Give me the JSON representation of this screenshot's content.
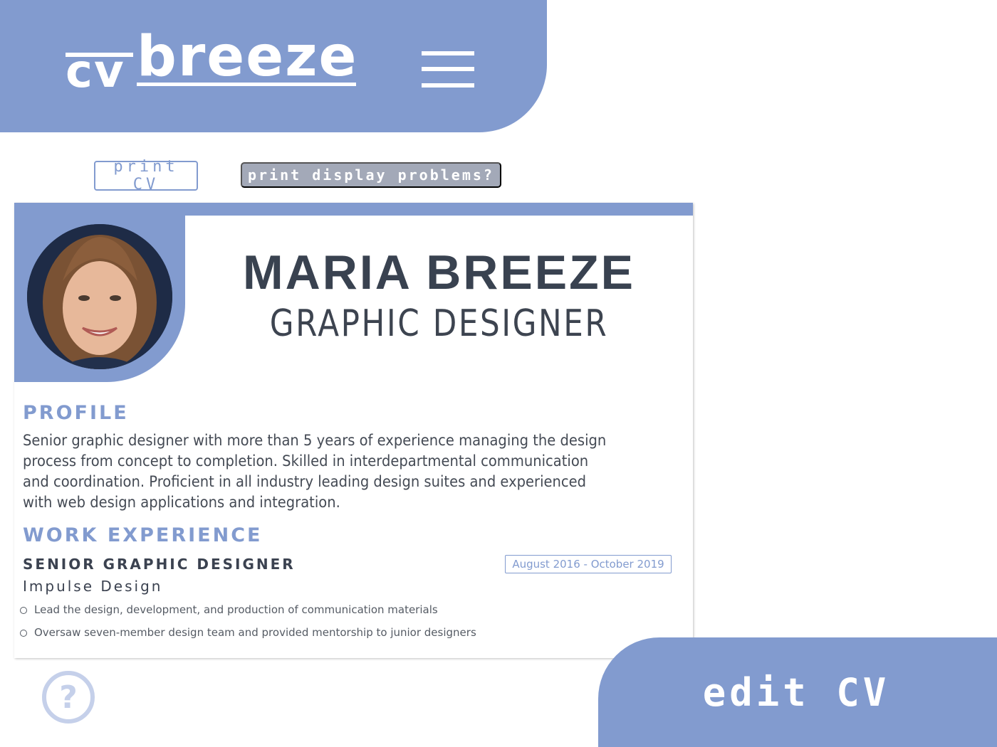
{
  "header": {
    "logo_prefix": "cv",
    "logo_main": "breeze",
    "menu_icon": "hamburger-menu-icon"
  },
  "actions": {
    "print_label": "print CV",
    "problems_label": "print display problems?"
  },
  "cv": {
    "name": "MARIA BREEZE",
    "title": "GRAPHIC DESIGNER",
    "profile_heading": "PROFILE",
    "profile_text": "Senior graphic designer with more than 5 years of experience managing the design process from concept to completion. Skilled in interdepartmental communication and coordination. Proficient in all industry leading design suites and experienced with web design applications and integration.",
    "work_heading": "WORK EXPERIENCE",
    "jobs": [
      {
        "title": "SENIOR GRAPHIC DESIGNER",
        "dates": "August 2016 - October 2019",
        "company": "Impulse Design",
        "bullets": [
          "Lead the design, development, and production of communication materials",
          "Oversaw seven-member design team and provided mentorship to junior designers"
        ]
      }
    ]
  },
  "help": {
    "icon": "help-circle-icon",
    "glyph": "?"
  },
  "edit": {
    "label": "edit CV"
  },
  "colors": {
    "accent": "#829bcf",
    "text_dark": "#394250",
    "button_gray": "#a3a9b8",
    "help_light": "#c5d0ea"
  }
}
